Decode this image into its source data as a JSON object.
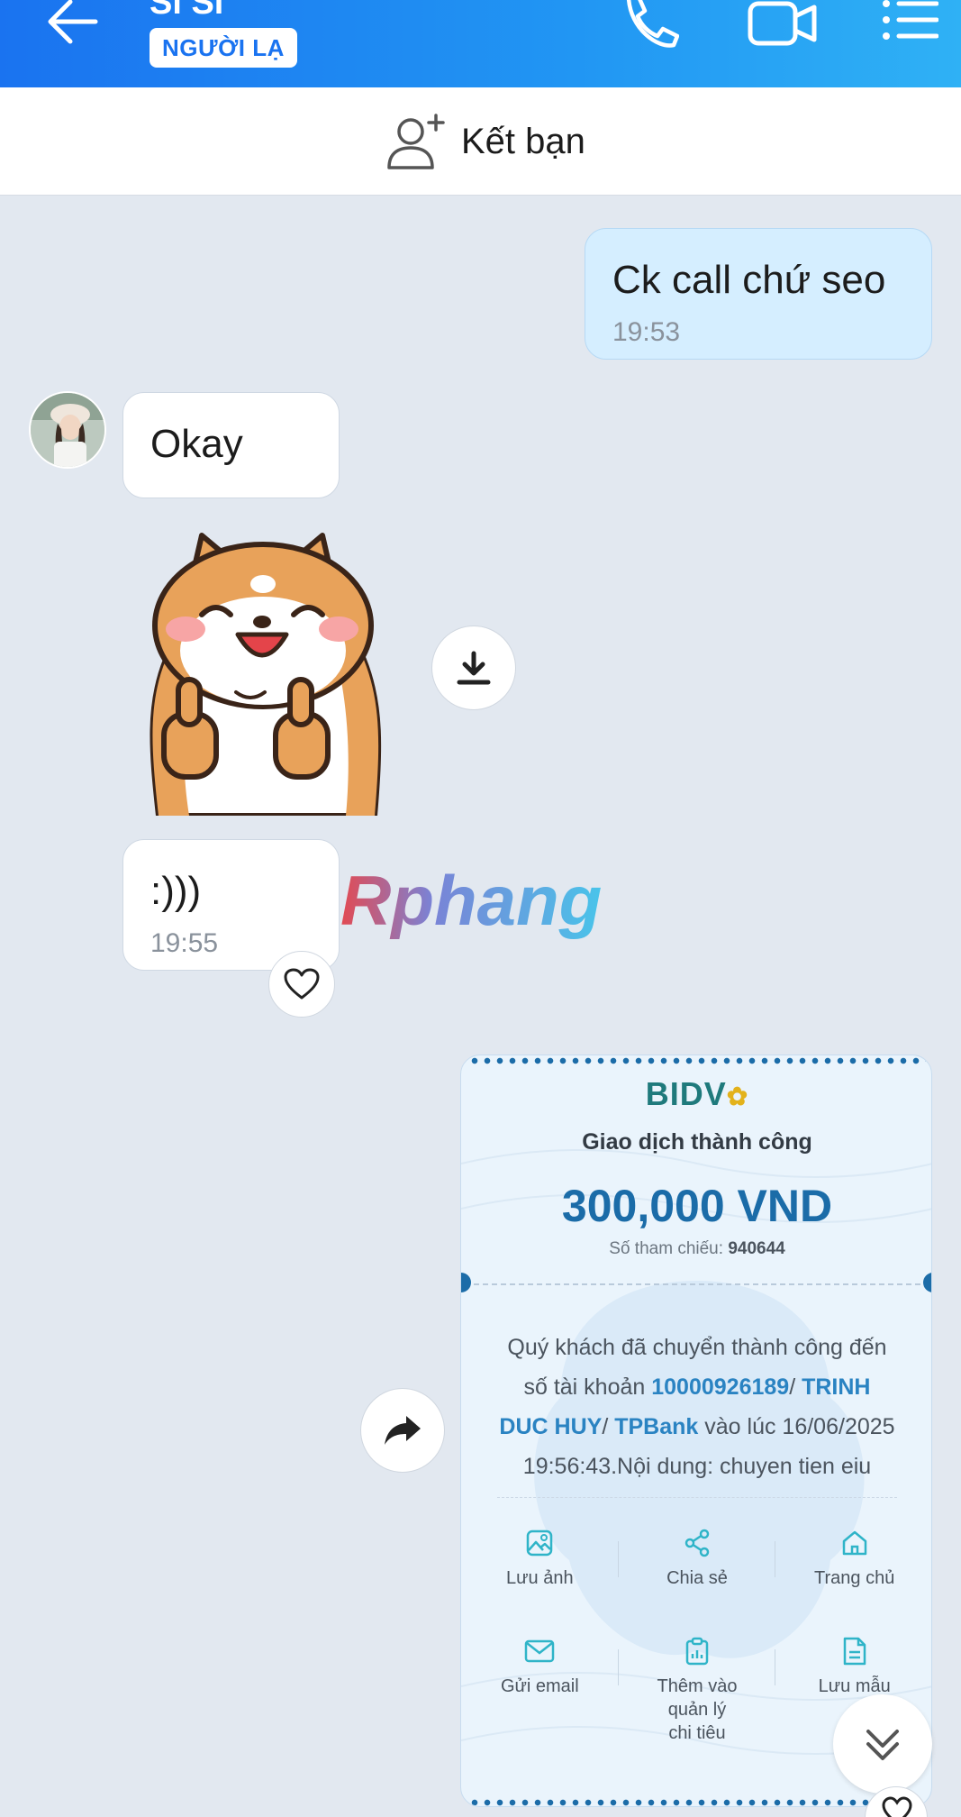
{
  "header": {
    "contact_name": "Si Si",
    "badge": "NGƯỜI LẠ",
    "icons": [
      "back-arrow-icon",
      "phone-icon",
      "video-call-icon",
      "menu-list-icon"
    ]
  },
  "friend_bar": {
    "label": "Kết bạn",
    "icon": "add-user-icon"
  },
  "messages": [
    {
      "from": "me",
      "text": "Ck call chứ seo",
      "time": "19:53"
    },
    {
      "from": "contact",
      "text": "Okay"
    },
    {
      "from": "contact",
      "type": "sticker",
      "sticker": "shiba-dog-thumbs-up"
    },
    {
      "from": "contact",
      "text": ":)))",
      "time": "19:55"
    }
  ],
  "watermark": "Rphang",
  "receipt": {
    "bank": "BIDV",
    "status": "Giao dịch thành công",
    "amount": "300,000 VND",
    "ref_label": "Số tham chiếu:",
    "ref_value": "940644",
    "desc_1": "Quý khách đã chuyển thành công đến",
    "desc_2a": "số tài khoản ",
    "desc_2b": "10000926189",
    "desc_2c": "/ ",
    "desc_2d": "TRINH",
    "desc_3a": "DUC HUY",
    "desc_3b": "/ ",
    "desc_3c": "TPBank",
    "desc_3d": " vào lúc 16/06/2025",
    "desc_4": "19:56:43.Nội dung: chuyen tien eiu",
    "actions_row1": [
      "Lưu ảnh",
      "Chia sẻ",
      "Trang chủ"
    ],
    "actions_row2": [
      "Gửi email",
      "Thêm vào\nquản lý\nchi tiêu",
      "Lưu mẫu"
    ]
  },
  "colors": {
    "header_start": "#1a73f0",
    "header_end": "#2fb1f5",
    "chat_bg": "#e2e8f0",
    "my_bubble": "#d5eeff",
    "bidv_teal": "#1f7a7c",
    "amount_blue": "#1b6ca8"
  }
}
